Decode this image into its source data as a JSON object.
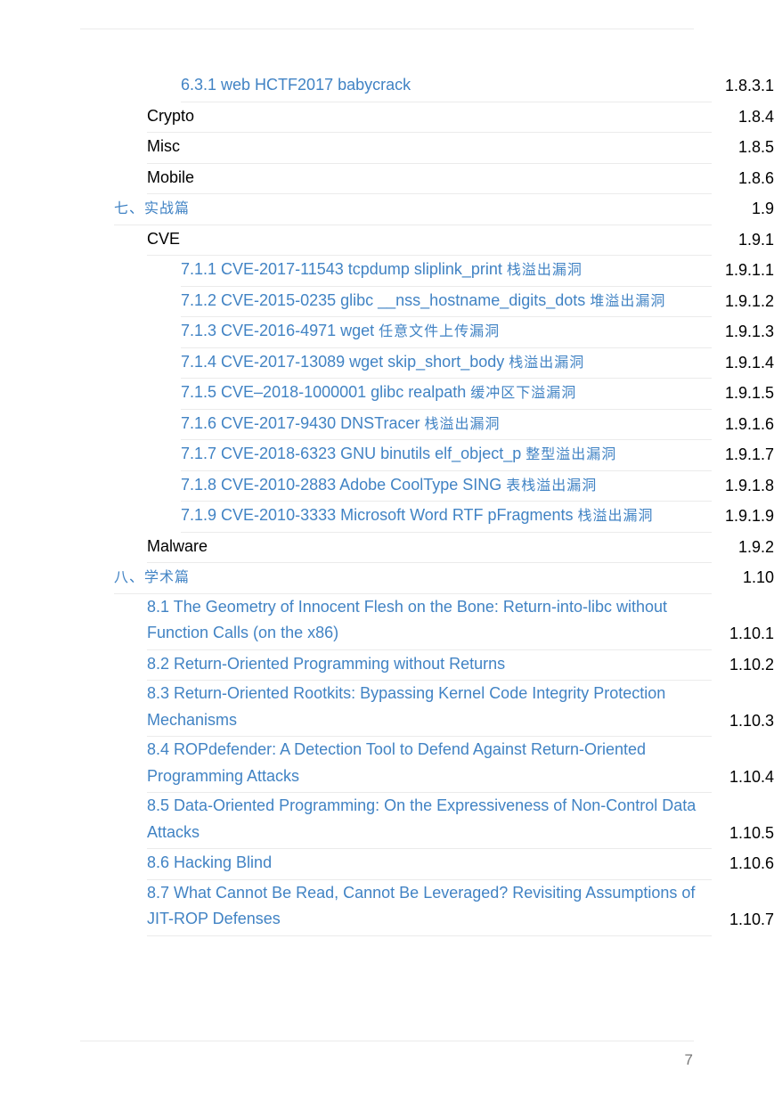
{
  "toc": [
    {
      "title": "6.3.1 web HCTF2017 babycrack",
      "num": "1.8.3.1",
      "level": 2,
      "link": true
    },
    {
      "title": "Crypto",
      "num": "1.8.4",
      "level": 1,
      "link": false
    },
    {
      "title": "Misc",
      "num": "1.8.5",
      "level": 1,
      "link": false
    },
    {
      "title": "Mobile",
      "num": "1.8.6",
      "level": 1,
      "link": false
    },
    {
      "title": "七、实战篇",
      "num": "1.9",
      "level": 0,
      "link": true
    },
    {
      "title": "CVE",
      "num": "1.9.1",
      "level": 1,
      "link": false
    },
    {
      "title": "7.1.1 CVE-2017-11543 tcpdump sliplink_print 栈溢出漏洞",
      "num": "1.9.1.1",
      "level": 2,
      "link": true
    },
    {
      "title": "7.1.2 CVE-2015-0235 glibc __nss_hostname_digits_dots 堆溢出漏洞",
      "num": "1.9.1.2",
      "level": 2,
      "link": true
    },
    {
      "title": "7.1.3 CVE-2016-4971 wget 任意文件上传漏洞",
      "num": "1.9.1.3",
      "level": 2,
      "link": true
    },
    {
      "title": "7.1.4 CVE-2017-13089 wget skip_short_body 栈溢出漏洞",
      "num": "1.9.1.4",
      "level": 2,
      "link": true
    },
    {
      "title": "7.1.5 CVE–2018-1000001 glibc realpath 缓冲区下溢漏洞",
      "num": "1.9.1.5",
      "level": 2,
      "link": true
    },
    {
      "title": "7.1.6 CVE-2017-9430 DNSTracer 栈溢出漏洞",
      "num": "1.9.1.6",
      "level": 2,
      "link": true
    },
    {
      "title": "7.1.7 CVE-2018-6323 GNU binutils elf_object_p 整型溢出漏洞",
      "num": "1.9.1.7",
      "level": 2,
      "link": true
    },
    {
      "title": "7.1.8 CVE-2010-2883 Adobe CoolType SING 表栈溢出漏洞",
      "num": "1.9.1.8",
      "level": 2,
      "link": true
    },
    {
      "title": "7.1.9 CVE-2010-3333 Microsoft Word RTF pFragments 栈溢出漏洞",
      "num": "1.9.1.9",
      "level": 2,
      "link": true
    },
    {
      "title": "Malware",
      "num": "1.9.2",
      "level": 1,
      "link": false
    },
    {
      "title": "八、学术篇",
      "num": "1.10",
      "level": 0,
      "link": true
    },
    {
      "title": "8.1 The Geometry of Innocent Flesh on the Bone: Return-into-libc without Function Calls (on the x86)",
      "num": "1.10.1",
      "level": 1,
      "link": true
    },
    {
      "title": "8.2 Return-Oriented Programming without Returns",
      "num": "1.10.2",
      "level": 1,
      "link": true
    },
    {
      "title": "8.3 Return-Oriented Rootkits: Bypassing Kernel Code Integrity Protection Mechanisms",
      "num": "1.10.3",
      "level": 1,
      "link": true
    },
    {
      "title": "8.4 ROPdefender: A Detection Tool to Defend Against Return-Oriented Programming Attacks",
      "num": "1.10.4",
      "level": 1,
      "link": true
    },
    {
      "title": "8.5 Data-Oriented Programming: On the Expressiveness of Non-Control Data Attacks",
      "num": "1.10.5",
      "level": 1,
      "link": true
    },
    {
      "title": "8.6 Hacking Blind",
      "num": "1.10.6",
      "level": 1,
      "link": true
    },
    {
      "title": "8.7 What Cannot Be Read, Cannot Be Leveraged? Revisiting Assumptions of JIT-ROP Defenses",
      "num": "1.10.7",
      "level": 1,
      "link": true
    }
  ],
  "page_number": "7",
  "colors": {
    "link": "#4183c4",
    "text": "#000000",
    "rule": "#ebebeb",
    "page_number": "#777777"
  }
}
